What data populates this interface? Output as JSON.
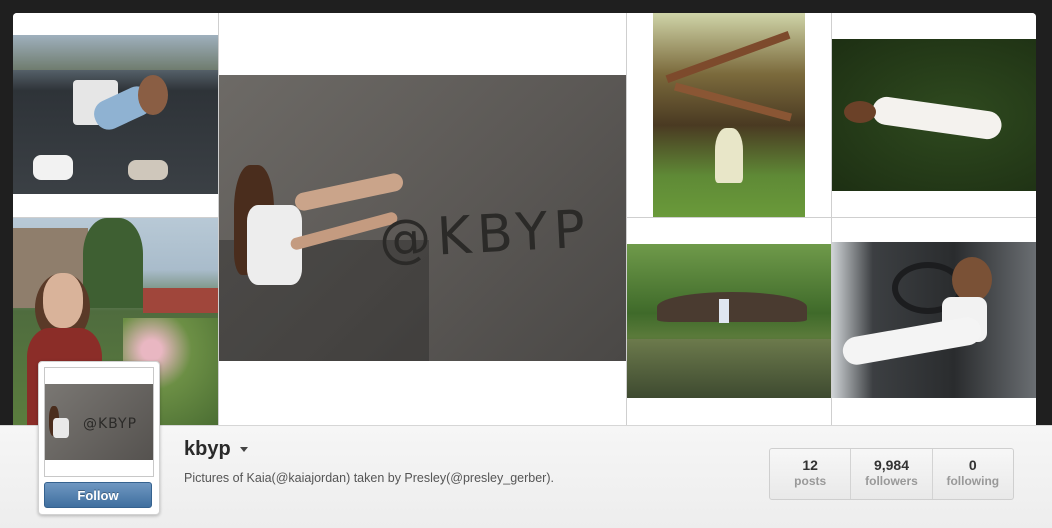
{
  "profile": {
    "username": "kbyp",
    "bio": "Pictures of Kaia(@kaiajordan) taken by Presley(@presley_gerber).",
    "follow_label": "Follow",
    "avatar_sand_text": "@KBYP"
  },
  "stats": [
    {
      "value": "12",
      "label": "posts"
    },
    {
      "value": "9,984",
      "label": "followers"
    },
    {
      "value": "0",
      "label": "following"
    }
  ],
  "collage": {
    "sand_text": "@KBYP",
    "photos": [
      "photo-truck-bed",
      "photo-flower-garden",
      "photo-sand-kbyp",
      "photo-forest-white-dress",
      "photo-lying-on-grass",
      "photo-river-tree",
      "photo-truck-seat"
    ]
  }
}
